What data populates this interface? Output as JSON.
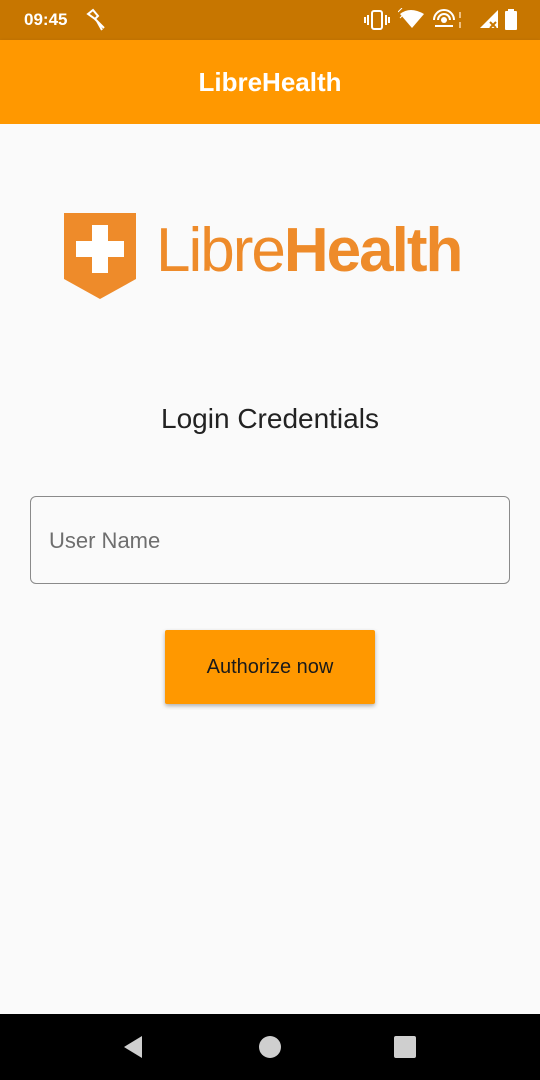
{
  "status_bar": {
    "time": "09:45",
    "icons": [
      "cleaning-icon",
      "vibrate-icon",
      "wifi-icon",
      "hotspot-icon",
      "signal-icon",
      "battery-icon"
    ]
  },
  "app_bar": {
    "title": "LibreHealth"
  },
  "logo": {
    "text_light": "Libre",
    "text_bold": "Health",
    "color": "#ee8b2a"
  },
  "login": {
    "heading": "Login Credentials",
    "username_placeholder": "User Name",
    "username_value": "",
    "authorize_label": "Authorize now"
  },
  "nav_bar": {
    "items": [
      "back-icon",
      "home-icon",
      "recents-icon"
    ]
  },
  "colors": {
    "accent": "#ff9800",
    "status_bar": "#c77600",
    "background": "#fafafa"
  }
}
